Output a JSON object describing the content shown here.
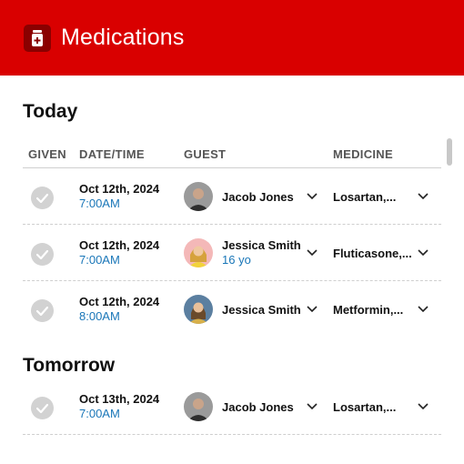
{
  "header": {
    "title": "Medications",
    "icon": "pill-bottle-icon"
  },
  "columns": {
    "given": "GIVEN",
    "datetime": "DATE/TIME",
    "guest": "GUEST",
    "medicine": "MEDICINE"
  },
  "sections": {
    "today": {
      "title": "Today",
      "rows": [
        {
          "date": "Oct 12th, 2024",
          "time": "7:00AM",
          "guest": "Jacob Jones",
          "age": "",
          "medicine": "Losartan,..."
        },
        {
          "date": "Oct 12th, 2024",
          "time": "7:00AM",
          "guest": "Jessica Smith",
          "age": "16 yo",
          "medicine": "Fluticasone,..."
        },
        {
          "date": "Oct 12th, 2024",
          "time": "8:00AM",
          "guest": "Jessica Smith",
          "age": "",
          "medicine": "Metformin,..."
        }
      ]
    },
    "tomorrow": {
      "title": "Tomorrow",
      "rows": [
        {
          "date": "Oct 13th, 2024",
          "time": "7:00AM",
          "guest": "Jacob Jones",
          "age": "",
          "medicine": "Losartan,..."
        }
      ]
    }
  },
  "colors": {
    "header": "#d90000",
    "accent_blue": "#1976b8"
  }
}
